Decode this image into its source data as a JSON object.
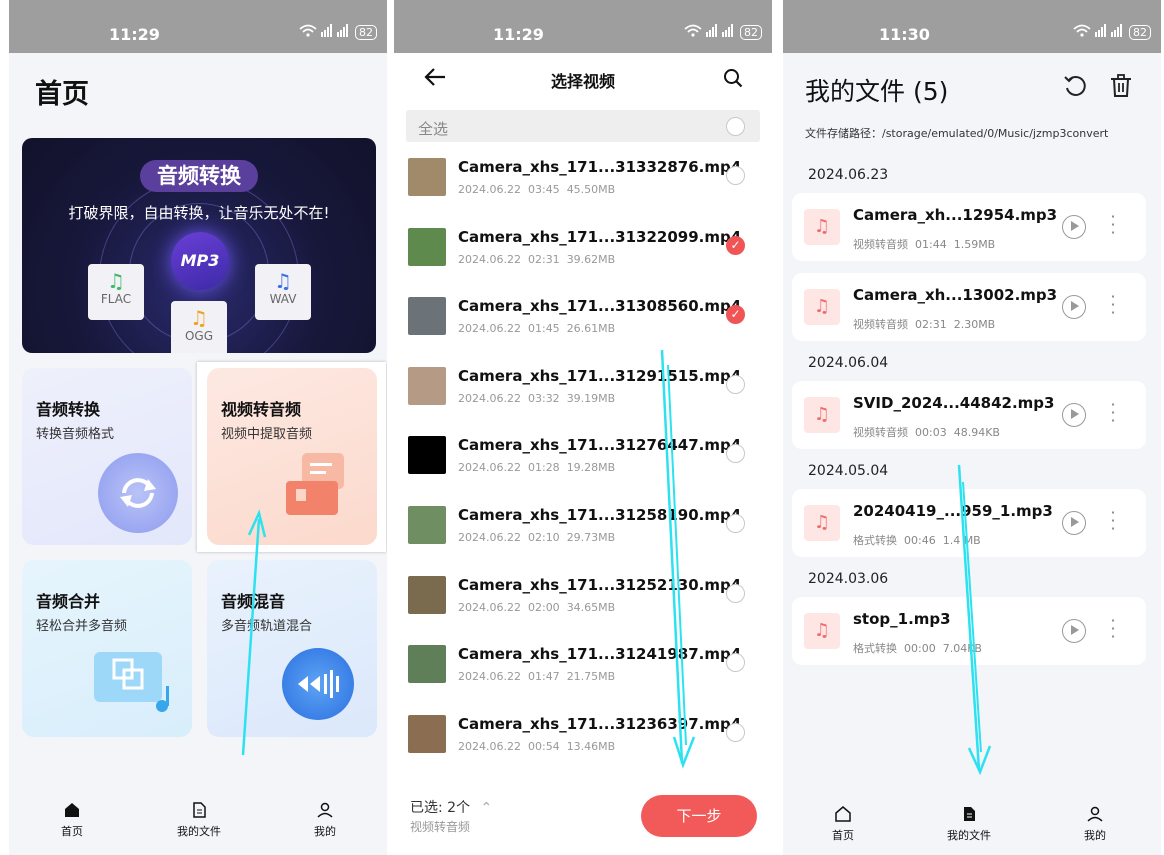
{
  "screen1": {
    "status": {
      "time": "11:29",
      "battery": "82"
    },
    "title": "首页",
    "banner": {
      "pill": "音频转换",
      "subtitle": "打破界限，自由转换，让音乐无处不在!",
      "center": "MP3",
      "formats": [
        "FLAC",
        "OGG",
        "WAV"
      ]
    },
    "tiles": [
      {
        "title": "音频转换",
        "sub": "转换音频格式"
      },
      {
        "title": "视频转音频",
        "sub": "视频中提取音频"
      },
      {
        "title": "音频合并",
        "sub": "轻松合并多音频"
      },
      {
        "title": "音频混音",
        "sub": "多音频轨道混合"
      }
    ],
    "tabs": [
      "首页",
      "我的文件",
      "我的"
    ]
  },
  "screen2": {
    "status": {
      "time": "11:29",
      "battery": "82"
    },
    "title": "选择视频",
    "select_all": "全选",
    "videos": [
      {
        "name": "Camera_xhs_171...31332876.mp4",
        "date": "2024.06.22",
        "duration": "03:45",
        "size": "45.50MB",
        "selected": false,
        "thumb": "#a08a6a"
      },
      {
        "name": "Camera_xhs_171...31322099.mp4",
        "date": "2024.06.22",
        "duration": "02:31",
        "size": "39.62MB",
        "selected": true,
        "thumb": "#5e8a4e"
      },
      {
        "name": "Camera_xhs_171...31308560.mp4",
        "date": "2024.06.22",
        "duration": "01:45",
        "size": "26.61MB",
        "selected": true,
        "thumb": "#6b7278"
      },
      {
        "name": "Camera_xhs_171...31291515.mp4",
        "date": "2024.06.22",
        "duration": "03:32",
        "size": "39.19MB",
        "selected": false,
        "thumb": "#b59b86"
      },
      {
        "name": "Camera_xhs_171...31276447.mp4",
        "date": "2024.06.22",
        "duration": "01:28",
        "size": "19.28MB",
        "selected": false,
        "thumb": "#000000"
      },
      {
        "name": "Camera_xhs_171...31258190.mp4",
        "date": "2024.06.22",
        "duration": "02:10",
        "size": "29.73MB",
        "selected": false,
        "thumb": "#6f8f63"
      },
      {
        "name": "Camera_xhs_171...31252130.mp4",
        "date": "2024.06.22",
        "duration": "02:00",
        "size": "34.65MB",
        "selected": false,
        "thumb": "#7a6a4e"
      },
      {
        "name": "Camera_xhs_171...31241987.mp4",
        "date": "2024.06.22",
        "duration": "01:47",
        "size": "21.75MB",
        "selected": false,
        "thumb": "#5f7f58"
      },
      {
        "name": "Camera_xhs_171...31236397.mp4",
        "date": "2024.06.22",
        "duration": "00:54",
        "size": "13.46MB",
        "selected": false,
        "thumb": "#8b6e52"
      }
    ],
    "selected_label": "已选:  2个",
    "selected_sub": "视频转音频",
    "next": "下一步"
  },
  "screen3": {
    "status": {
      "time": "11:30",
      "battery": "82"
    },
    "title": "我的文件 (5)",
    "path": "文件存储路径：/storage/emulated/0/Music/jzmp3convert",
    "groups": [
      {
        "date": "2024.06.23",
        "files": [
          {
            "name": "Camera_xh...12954.mp3",
            "type": "视频转音频",
            "duration": "01:44",
            "size": "1.59MB"
          },
          {
            "name": "Camera_xh...13002.mp3",
            "type": "视频转音频",
            "duration": "02:31",
            "size": "2.30MB"
          }
        ]
      },
      {
        "date": "2024.06.04",
        "files": [
          {
            "name": "SVID_2024...44842.mp3",
            "type": "视频转音频",
            "duration": "00:03",
            "size": "48.94KB"
          }
        ]
      },
      {
        "date": "2024.05.04",
        "files": [
          {
            "name": "20240419_...959_1.mp3",
            "type": "格式转换",
            "duration": "00:46",
            "size": "1.4 MB"
          }
        ]
      },
      {
        "date": "2024.03.06",
        "files": [
          {
            "name": "stop_1.mp3",
            "type": "格式转换",
            "duration": "00:00",
            "size": "7.04KB"
          }
        ]
      }
    ],
    "tabs": [
      "首页",
      "我的文件",
      "我的"
    ]
  }
}
